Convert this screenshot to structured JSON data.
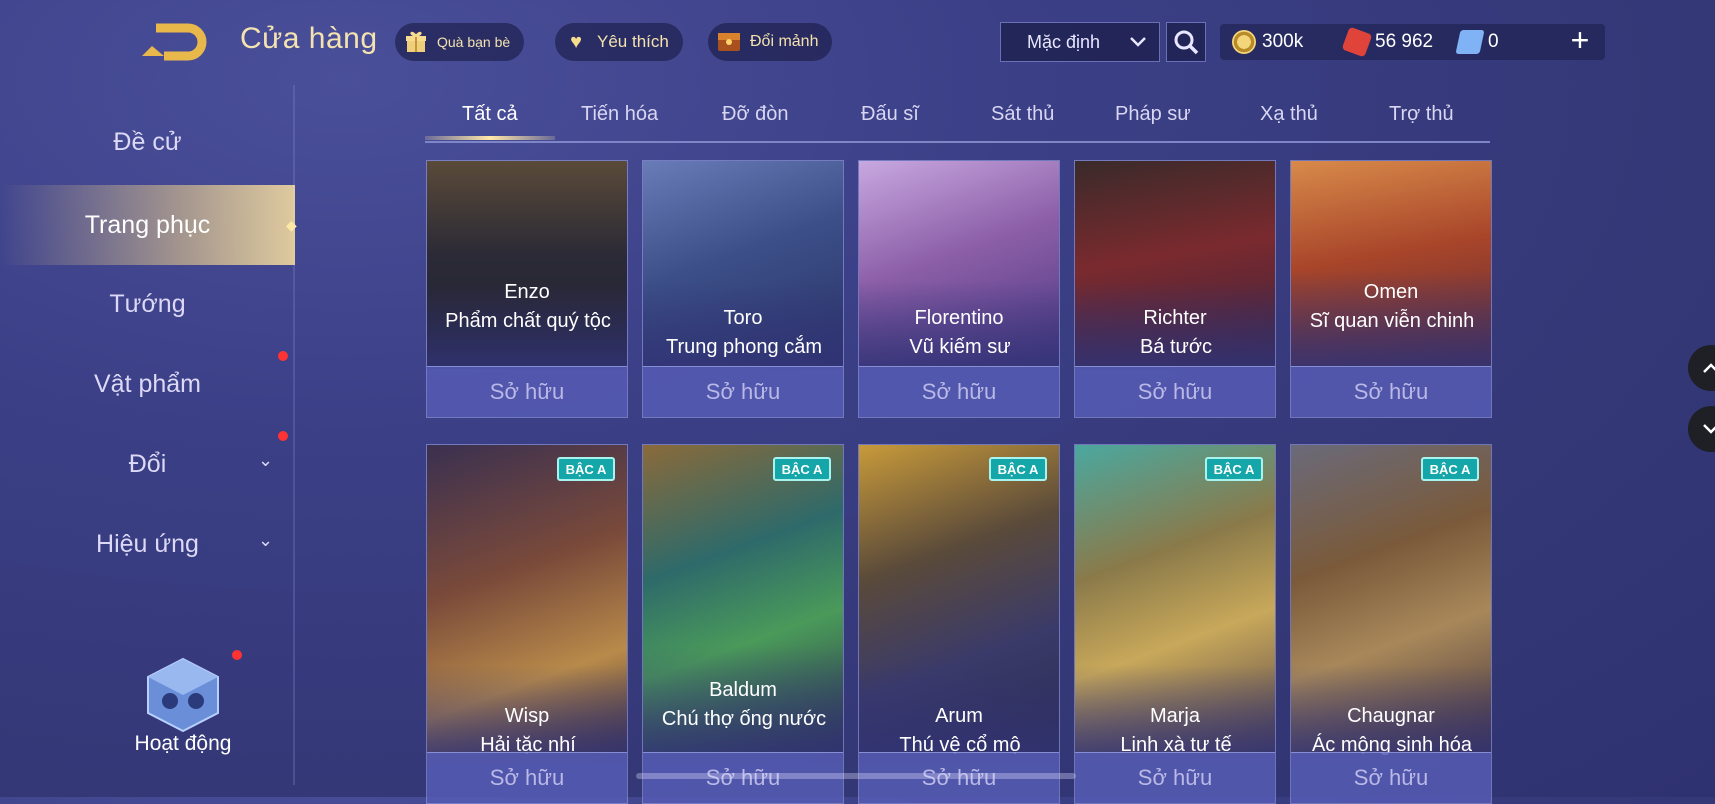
{
  "header": {
    "title": "Cửa hàng",
    "buttons": [
      {
        "label": "Quà bạn bè",
        "icon": "gift-icon"
      },
      {
        "label": "Yêu thích",
        "icon": "heart-icon"
      },
      {
        "label": "Đổi mảnh",
        "icon": "chest-icon"
      }
    ],
    "sort_value": "Mặc định",
    "currencies": [
      {
        "value": "300k",
        "icon": "gold-coin-icon",
        "color": "#d9b64a"
      },
      {
        "value": "56 962",
        "icon": "ruby-icon",
        "color": "#e0433a"
      },
      {
        "value": "0",
        "icon": "voucher-icon",
        "color": "#7fb3f5"
      }
    ]
  },
  "sidebar": {
    "items": [
      {
        "label": "Đề cử"
      },
      {
        "label": "Trang phục"
      },
      {
        "label": "Tướng"
      },
      {
        "label": "Vật phẩm"
      },
      {
        "label": "Đổi"
      },
      {
        "label": "Hiệu ứng"
      }
    ],
    "activity_label": "Hoạt động"
  },
  "tabs": [
    {
      "label": "Tất cả"
    },
    {
      "label": "Tiến hóa"
    },
    {
      "label": "Đỡ đòn"
    },
    {
      "label": "Đấu sĩ"
    },
    {
      "label": "Sát thủ"
    },
    {
      "label": "Pháp sư"
    },
    {
      "label": "Xạ thủ"
    },
    {
      "label": "Trợ thủ"
    }
  ],
  "cards_row1": [
    {
      "hero": "Enzo",
      "skin": "Phẩm chất quý tộc",
      "status": "Sở hữu",
      "color": "#2b2a36"
    },
    {
      "hero": "Toro",
      "skin": "Trung phong cắm",
      "status": "Sở hữu",
      "color": "#3c4f88"
    },
    {
      "hero": "Florentino",
      "skin": "Vũ kiếm sư",
      "status": "Sở hữu",
      "color": "#8c5fa8"
    },
    {
      "hero": "Richter",
      "skin": "Bá tước",
      "status": "Sở hữu",
      "color": "#7a2a2e"
    },
    {
      "hero": "Omen",
      "skin": "Sĩ quan viễn chinh",
      "status": "Sở hữu",
      "color": "#a8452a"
    }
  ],
  "cards_row2": [
    {
      "hero": "Wisp",
      "skin": "Hải tặc nhí",
      "status": "Sở hữu",
      "badge": "BẬC A",
      "color": "#7a4a3a"
    },
    {
      "hero": "Baldum",
      "skin": "Chú thợ ống nước",
      "status": "Sở hữu",
      "badge": "BẬC A",
      "color": "#2e6a6a"
    },
    {
      "hero": "Arum",
      "skin": "Thú vệ cổ mộ",
      "status": "Sở hữu",
      "badge": "BẬC A",
      "color": "#5a4a3a"
    },
    {
      "hero": "Marja",
      "skin": "Linh xà tư tế",
      "status": "Sở hữu",
      "badge": "BẬC A",
      "color": "#8a7a4a"
    },
    {
      "hero": "Chaugnar",
      "skin": "Ác mộng sinh hóa",
      "status": "Sở hữu",
      "badge": "BẬC A",
      "color": "#7a5a3a"
    }
  ]
}
